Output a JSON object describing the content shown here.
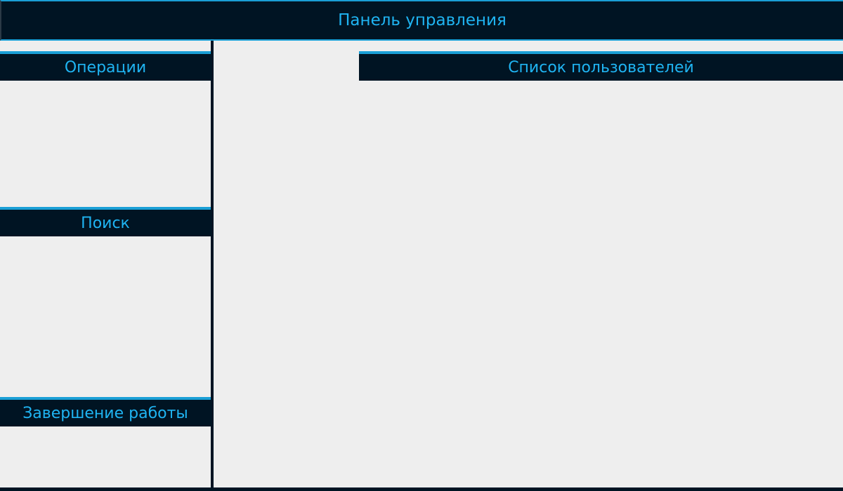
{
  "header": {
    "title": "Панель управления"
  },
  "sidebar": {
    "sections": [
      {
        "label": "Операции"
      },
      {
        "label": "Поиск"
      },
      {
        "label": "Завершение работы"
      }
    ]
  },
  "main": {
    "panel_title": "Список пользователей"
  },
  "colors": {
    "header_bg": "#001423",
    "accent": "#1a9fd6",
    "title_text": "#1fb4f2",
    "background": "#eeeeee"
  }
}
